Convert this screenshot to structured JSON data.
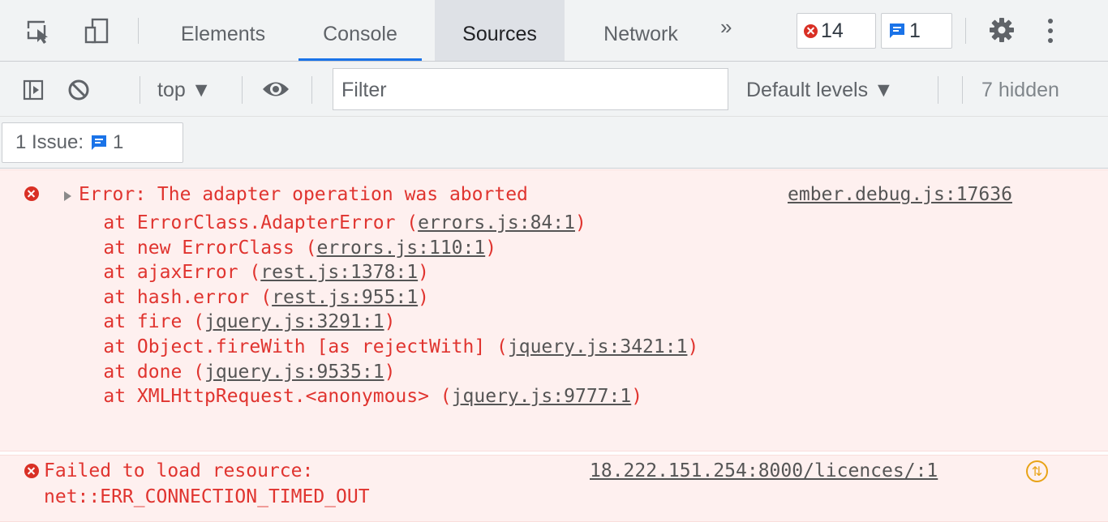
{
  "tabbar": {
    "tabs": [
      {
        "label": "Elements"
      },
      {
        "label": "Console"
      },
      {
        "label": "Sources"
      },
      {
        "label": "Network"
      }
    ],
    "more_tabs": "»",
    "error_count": "14",
    "message_count": "1"
  },
  "toolbar": {
    "context": "top ▼",
    "filter_placeholder": "Filter",
    "levels": "Default levels ▼",
    "hidden": "7 hidden"
  },
  "issues": {
    "label": "1 Issue:",
    "count": "1"
  },
  "messages": {
    "error1": {
      "text": "Error: The adapter operation was aborted",
      "source": "ember.debug.js:17636",
      "stack": [
        {
          "prefix": "    at ErrorClass.AdapterError (",
          "link": "errors.js:84:1",
          "suffix": ")"
        },
        {
          "prefix": "    at new ErrorClass (",
          "link": "errors.js:110:1",
          "suffix": ")"
        },
        {
          "prefix": "    at ajaxError (",
          "link": "rest.js:1378:1",
          "suffix": ")"
        },
        {
          "prefix": "    at hash.error (",
          "link": "rest.js:955:1",
          "suffix": ")"
        },
        {
          "prefix": "    at fire (",
          "link": "jquery.js:3291:1",
          "suffix": ")"
        },
        {
          "prefix": "    at Object.fireWith [as rejectWith] (",
          "link": "jquery.js:3421:1",
          "suffix": ")"
        },
        {
          "prefix": "    at done (",
          "link": "jquery.js:9535:1",
          "suffix": ")"
        },
        {
          "prefix": "    at XMLHttpRequest.<anonymous> (",
          "link": "jquery.js:9777:1",
          "suffix": ")"
        }
      ]
    },
    "error2": {
      "line1": "Failed to load resource:",
      "line2": "net::ERR_CONNECTION_TIMED_OUT",
      "source": "18.222.151.254:8000/licences/:1"
    }
  },
  "colors": {
    "error_red": "#e0342f",
    "error_bg": "#fef0ef",
    "accent_blue": "#1a73e8"
  }
}
